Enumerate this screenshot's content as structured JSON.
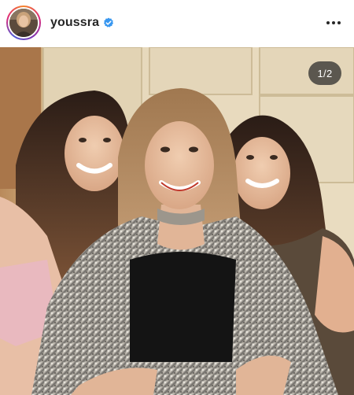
{
  "header": {
    "username": "youssra",
    "verified": true,
    "avatar_icon": "profile-avatar",
    "verified_icon": "verified-badge-icon",
    "more_icon": "more-options-icon"
  },
  "media": {
    "counter": "1/2",
    "current_index": 1,
    "total": 2,
    "description_icon": "photo"
  },
  "colors": {
    "verified": "#3897f0",
    "username": "#262626",
    "counter_bg": "#262626"
  }
}
